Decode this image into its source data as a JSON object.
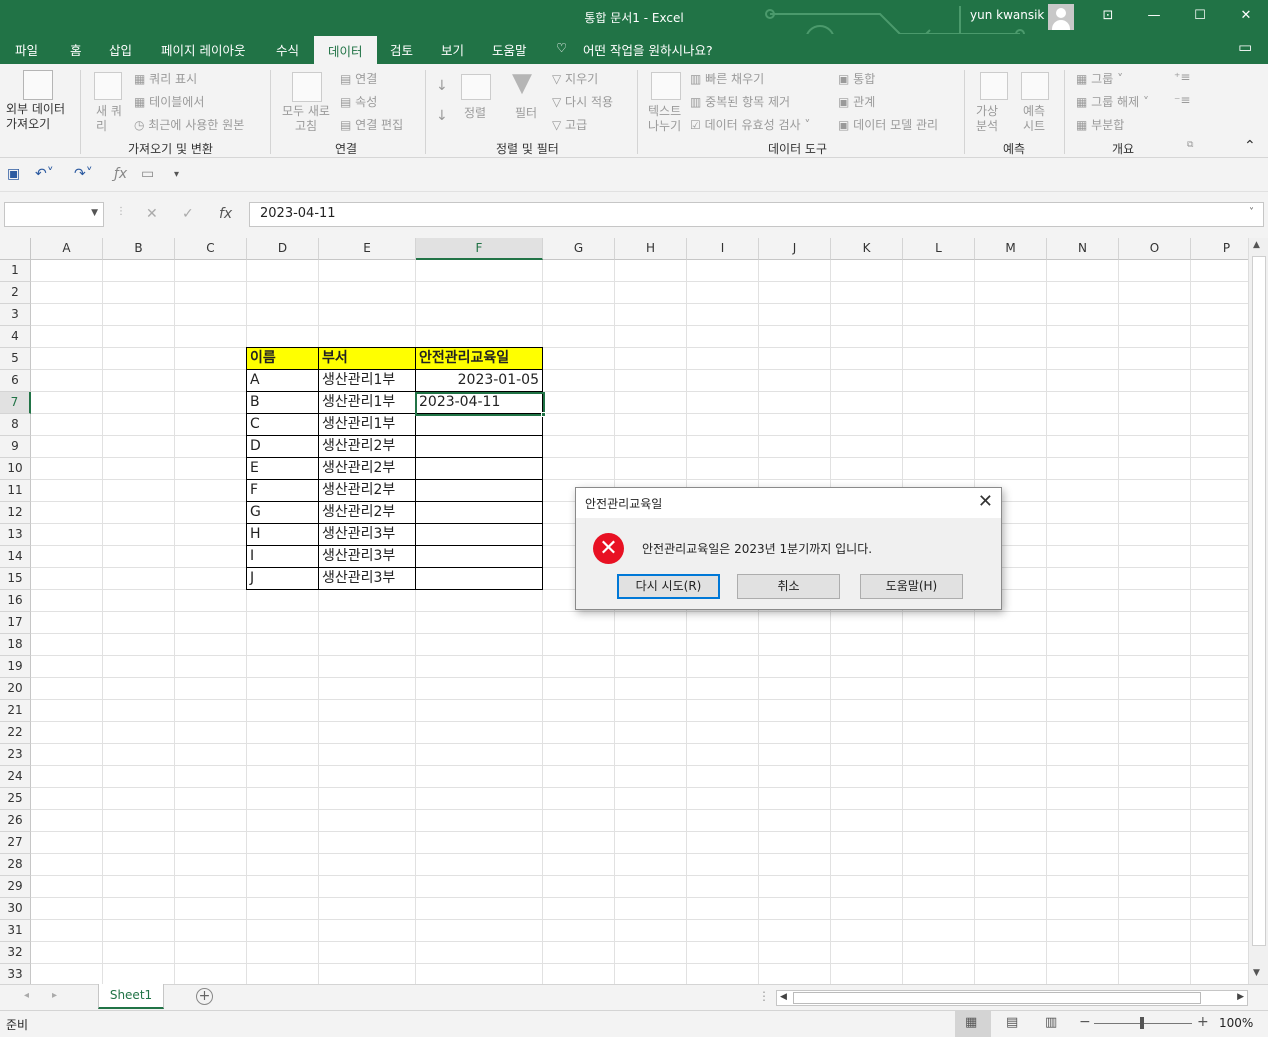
{
  "window": {
    "title": "통합 문서1  -  Excel",
    "user": "yun kwansik"
  },
  "menu": [
    "파일",
    "홈",
    "삽입",
    "페이지 레이아웃",
    "수식",
    "데이터",
    "검토",
    "보기",
    "도움말"
  ],
  "menu_active": "데이터",
  "tell_me": "어떤 작업을 원하시나요?",
  "ribbon": {
    "external_data": "외부 데이터\n가져오기",
    "new_query": "새 쿼\n리",
    "show_queries": "쿼리 표시",
    "from_table": "테이블에서",
    "recent_sources": "최근에 사용한 원본",
    "group_get": "가져오기 및 변환",
    "refresh_all": "모두 새로\n고침",
    "connections": "연결",
    "properties": "속성",
    "edit_links": "연결 편집",
    "group_conn": "연결",
    "sort": "정렬",
    "filter": "필터",
    "clear": "지우기",
    "reapply": "다시 적용",
    "advanced": "고급",
    "group_sort": "정렬 및 필터",
    "text_to_columns": "텍스트\n나누기",
    "flash_fill": "빠른 채우기",
    "remove_dup": "중복된 항목 제거",
    "validation": "데이터 유효성 검사",
    "consolidate": "통합",
    "relationships": "관계",
    "data_model": "데이터 모델 관리",
    "group_tools": "데이터 도구",
    "whatif": "가상\n분석",
    "forecast_sheet": "예측\n시트",
    "group_forecast": "예측",
    "group_btn": "그룹",
    "ungroup": "그룹 해제",
    "subtotal": "부분합",
    "group_outline": "개요"
  },
  "formula_bar": {
    "value": "2023-04-11",
    "fx": "fx"
  },
  "columns": [
    "A",
    "B",
    "C",
    "D",
    "E",
    "F",
    "G",
    "H",
    "I",
    "J",
    "K",
    "L",
    "M",
    "N",
    "O",
    "P"
  ],
  "rows": [
    "1",
    "2",
    "3",
    "4",
    "5",
    "6",
    "7",
    "8",
    "9",
    "10",
    "11",
    "12",
    "13",
    "14",
    "15",
    "16",
    "17",
    "18",
    "19",
    "20",
    "21",
    "22",
    "23",
    "24",
    "25",
    "26",
    "27",
    "28",
    "29",
    "30",
    "31",
    "32",
    "33"
  ],
  "table": {
    "headers": [
      "이름",
      "부서",
      "안전관리교육일"
    ],
    "rows": [
      [
        "A",
        "생산관리1부",
        "2023-01-05"
      ],
      [
        "B",
        "생산관리1부",
        "2023-04-11"
      ],
      [
        "C",
        "생산관리1부",
        ""
      ],
      [
        "D",
        "생산관리2부",
        ""
      ],
      [
        "E",
        "생산관리2부",
        ""
      ],
      [
        "F",
        "생산관리2부",
        ""
      ],
      [
        "G",
        "생산관리2부",
        ""
      ],
      [
        "H",
        "생산관리3부",
        ""
      ],
      [
        "I",
        "생산관리3부",
        ""
      ],
      [
        "J",
        "생산관리3부",
        ""
      ]
    ]
  },
  "dialog": {
    "title": "안전관리교육일",
    "message": "안전관리교육일은 2023년 1분기까지 입니다.",
    "retry": "다시 시도(R)",
    "cancel": "취소",
    "help": "도움말(H)"
  },
  "sheet_tab": "Sheet1",
  "status": {
    "ready": "준비",
    "zoom": "100%"
  },
  "colors": {
    "excel_green": "#217346",
    "header_fill": "#ffff00",
    "error_red": "#e81123"
  }
}
